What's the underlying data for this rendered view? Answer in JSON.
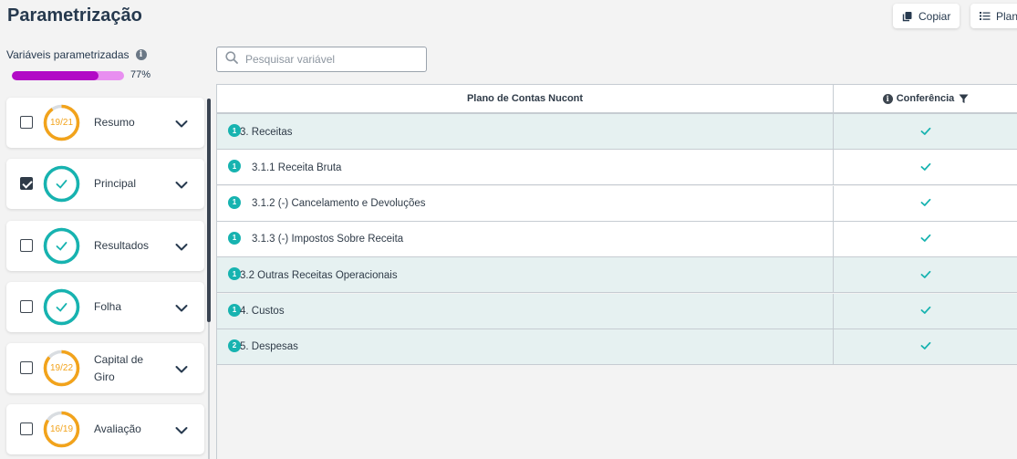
{
  "page_title": "Parametrização",
  "toolbar": {
    "copy_label": "Copiar",
    "plan_label": "Plan"
  },
  "progress": {
    "label": "Variáveis parametrizadas",
    "percent_text": "77%",
    "value": 0.77,
    "fill_color": "#b20ac6",
    "track_color": "#e88ff0"
  },
  "sidebar": {
    "items": [
      {
        "label": "Resumo",
        "checked": false,
        "ring_text": "19/21",
        "complete": false,
        "fraction": 0.905
      },
      {
        "label": "Principal",
        "checked": true,
        "ring_text": "",
        "complete": true,
        "fraction": 1
      },
      {
        "label": "Resultados",
        "checked": false,
        "ring_text": "",
        "complete": true,
        "fraction": 1
      },
      {
        "label": "Folha",
        "checked": false,
        "ring_text": "",
        "complete": true,
        "fraction": 1
      },
      {
        "label": "Capital de Giro",
        "checked": false,
        "ring_text": "19/22",
        "complete": false,
        "fraction": 0.864
      },
      {
        "label": "Avaliação",
        "checked": false,
        "ring_text": "16/19",
        "complete": false,
        "fraction": 0.842
      }
    ]
  },
  "search": {
    "placeholder": "Pesquisar variável",
    "value": ""
  },
  "table": {
    "headers": {
      "plan": "Plano de Contas Nucont",
      "conference": "Conferência"
    },
    "rows": [
      {
        "badge": "1",
        "name": "3. Receitas",
        "type": "group",
        "checked": true
      },
      {
        "badge": "1",
        "name": "3.1.1 Receita Bruta",
        "type": "item",
        "checked": true
      },
      {
        "badge": "1",
        "name": "3.1.2 (-) Cancelamento e Devoluções",
        "type": "item",
        "checked": true
      },
      {
        "badge": "1",
        "name": "3.1.3 (-) Impostos Sobre Receita",
        "type": "item",
        "checked": true
      },
      {
        "badge": "1",
        "name": "3.2 Outras Receitas Operacionais",
        "type": "group",
        "checked": true
      },
      {
        "badge": "1",
        "name": "4. Custos",
        "type": "group",
        "checked": true
      },
      {
        "badge": "2",
        "name": "5. Despesas",
        "type": "group",
        "checked": true
      }
    ]
  },
  "colors": {
    "complete_ring": "#17b3b0",
    "partial_ring": "#f2a31b",
    "ring_remainder": "#d9dde1",
    "check": "#17b3b0"
  },
  "icons": {
    "copy": "copy-icon",
    "plan": "list-icon",
    "search": "search-icon",
    "info": "info-icon",
    "filter": "filter-icon",
    "chevron": "chevron-down-icon",
    "check": "check-icon"
  }
}
